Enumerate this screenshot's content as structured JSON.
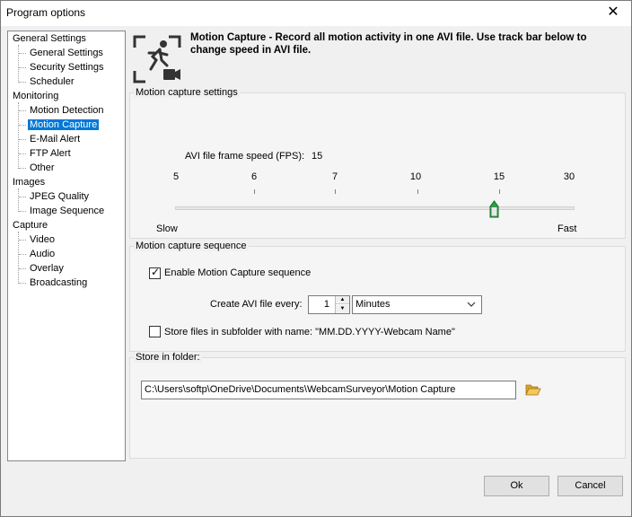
{
  "window": {
    "title": "Program options",
    "close_glyph": "✕"
  },
  "tree": {
    "nodes": [
      {
        "label": "General Settings",
        "level": 0
      },
      {
        "label": "General Settings",
        "level": 1
      },
      {
        "label": "Security Settings",
        "level": 1
      },
      {
        "label": "Scheduler",
        "level": 1
      },
      {
        "label": "Monitoring",
        "level": 0
      },
      {
        "label": "Motion Detection",
        "level": 1
      },
      {
        "label": "Motion Capture",
        "level": 1,
        "selected": true
      },
      {
        "label": "E-Mail Alert",
        "level": 1
      },
      {
        "label": "FTP Alert",
        "level": 1
      },
      {
        "label": "Other",
        "level": 1
      },
      {
        "label": "Images",
        "level": 0
      },
      {
        "label": "JPEG Quality",
        "level": 1
      },
      {
        "label": "Image Sequence",
        "level": 1
      },
      {
        "label": "Capture",
        "level": 0
      },
      {
        "label": "Video",
        "level": 1
      },
      {
        "label": "Audio",
        "level": 1
      },
      {
        "label": "Overlay",
        "level": 1
      },
      {
        "label": "Broadcasting",
        "level": 1
      }
    ]
  },
  "header": {
    "icon": "motion-capture-icon",
    "description": "Motion Capture - Record all motion activity in one AVI file. Use track bar below to change speed in AVI file."
  },
  "settings": {
    "title": "Motion capture settings",
    "fps_label": "AVI file frame speed (FPS):",
    "fps_value": "15",
    "ticks": [
      "5",
      "6",
      "7",
      "10",
      "15",
      "30"
    ],
    "slow_label": "Slow",
    "fast_label": "Fast",
    "slider_value": "15"
  },
  "sequence": {
    "title": "Motion capture sequence",
    "enable_label": "Enable Motion Capture sequence",
    "enable_checked": true,
    "create_label": "Create AVI file every:",
    "interval_value": "1",
    "interval_unit": "Minutes",
    "subfolder_label": "Store files in subfolder with name: \"MM.DD.YYYY-Webcam Name\"",
    "subfolder_checked": false
  },
  "folder": {
    "title": "Store in folder:",
    "path": "C:\\Users\\softp\\OneDrive\\Documents\\WebcamSurveyor\\Motion Capture",
    "browse_icon": "folder-open-icon"
  },
  "buttons": {
    "ok": "Ok",
    "cancel": "Cancel"
  },
  "colors": {
    "selection": "#0078d7",
    "folder_icon": "#e8b84a",
    "thumb": "#2e9e44"
  }
}
